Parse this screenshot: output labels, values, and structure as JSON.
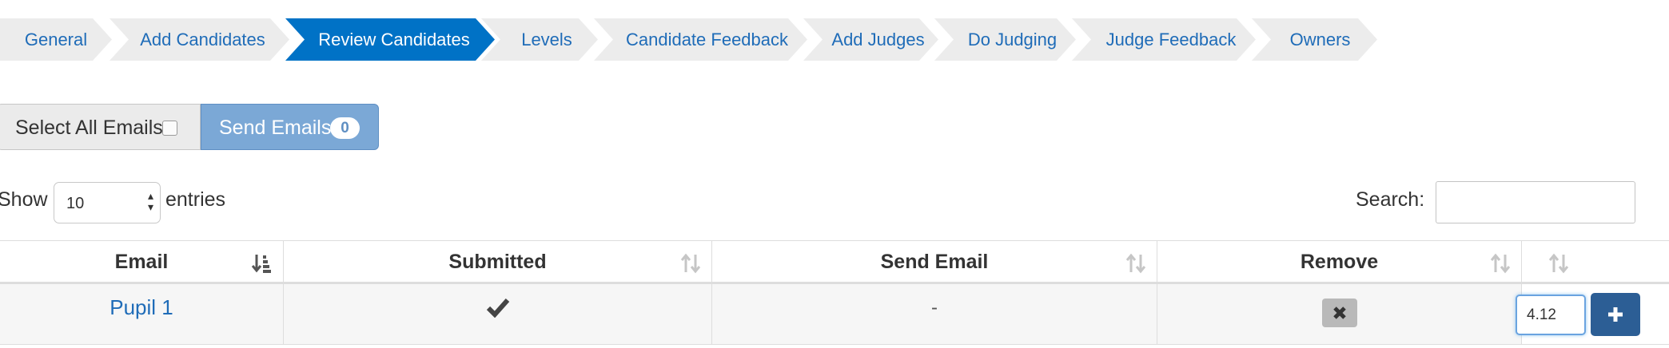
{
  "wizard": {
    "steps": [
      {
        "label": "General",
        "active": false
      },
      {
        "label": "Add Candidates",
        "active": false
      },
      {
        "label": "Review Candidates",
        "active": true
      },
      {
        "label": "Levels",
        "active": false
      },
      {
        "label": "Candidate Feedback",
        "active": false
      },
      {
        "label": "Add Judges",
        "active": false
      },
      {
        "label": "Do Judging",
        "active": false
      },
      {
        "label": "Judge Feedback",
        "active": false
      },
      {
        "label": "Owners",
        "active": false
      }
    ]
  },
  "actions": {
    "select_all_label": "Select All Emails",
    "select_all_checked": false,
    "send_emails_label": "Send Emails",
    "send_emails_count": "0"
  },
  "table_controls": {
    "show_label": "Show",
    "page_length": "10",
    "entries_label": "entries",
    "search_label": "Search:",
    "search_value": ""
  },
  "table": {
    "columns": [
      "Email",
      "Submitted",
      "Send Email",
      "Remove",
      ""
    ],
    "rows": [
      {
        "email": "Pupil 1",
        "submitted": "✔",
        "send_email": "-",
        "remove_icon": "close-icon",
        "level_value": "4.12",
        "add_icon": "plus-icon"
      }
    ]
  },
  "colors": {
    "active_step": "#0072c6",
    "inactive_step": "#ececec",
    "link": "#1f6cb8",
    "send_button": "#7ba8d6",
    "add_button": "#2c5e95"
  }
}
